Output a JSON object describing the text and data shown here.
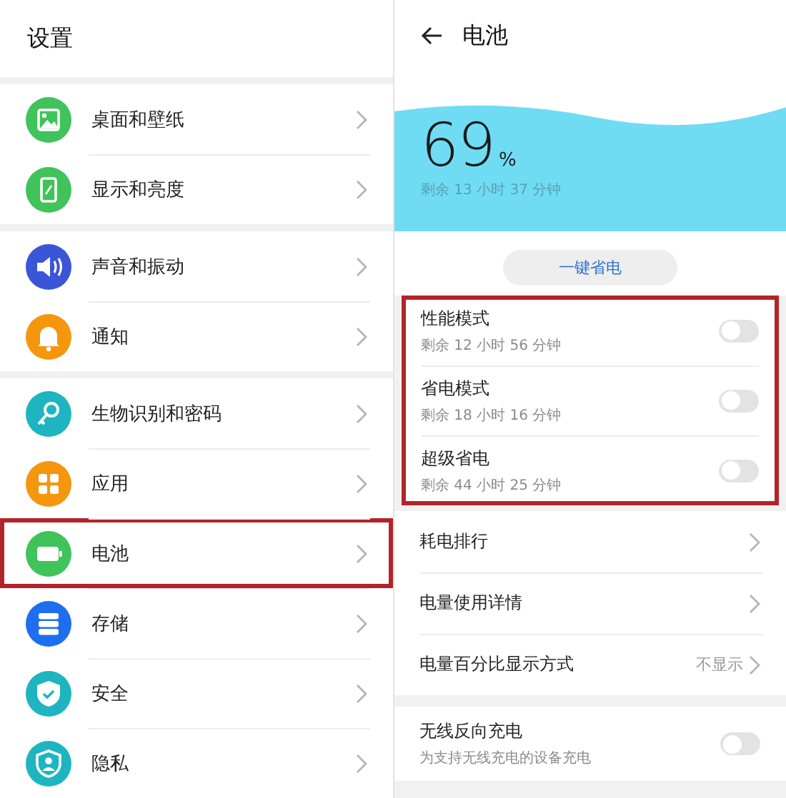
{
  "settings": {
    "title": "设置",
    "groups": [
      {
        "items": [
          {
            "label": "桌面和壁纸",
            "kind": "image",
            "color": "#3fc35a",
            "highlighted": false
          },
          {
            "label": "显示和亮度",
            "kind": "display",
            "color": "#3fc35a",
            "highlighted": false
          }
        ]
      },
      {
        "items": [
          {
            "label": "声音和振动",
            "kind": "sound",
            "color": "#3b55d9",
            "highlighted": false
          },
          {
            "label": "通知",
            "kind": "bell",
            "color": "#f5960f",
            "highlighted": false
          }
        ]
      },
      {
        "items": [
          {
            "label": "生物识别和密码",
            "kind": "key",
            "color": "#1eb5c0",
            "highlighted": false
          },
          {
            "label": "应用",
            "kind": "apps",
            "color": "#f5960f",
            "highlighted": false
          },
          {
            "label": "电池",
            "kind": "battery",
            "color": "#3fc35a",
            "highlighted": true
          },
          {
            "label": "存储",
            "kind": "storage",
            "color": "#1f6ef0",
            "highlighted": false
          },
          {
            "label": "安全",
            "kind": "shield",
            "color": "#1eb5c0",
            "highlighted": false
          },
          {
            "label": "隐私",
            "kind": "privacy",
            "color": "#1eb5c0",
            "highlighted": false
          }
        ]
      }
    ]
  },
  "battery": {
    "title": "电池",
    "percent": "69",
    "percent_sign": "%",
    "remaining": "剩余 13 小时 37 分钟",
    "save_button": "一键省电",
    "modes_highlighted": true,
    "modes": [
      {
        "title": "性能模式",
        "subtitle": "剩余 12 小时 56 分钟",
        "on": false
      },
      {
        "title": "省电模式",
        "subtitle": "剩余 18 小时 16 分钟",
        "on": false
      },
      {
        "title": "超级省电",
        "subtitle": "剩余 44 小时 25 分钟",
        "on": false
      }
    ],
    "links": [
      {
        "label": "耗电排行"
      },
      {
        "label": "电量使用详情"
      },
      {
        "label": "电量百分比显示方式",
        "value": "不显示"
      }
    ],
    "wireless": {
      "title": "无线反向充电",
      "subtitle": "为支持无线充电的设备充电",
      "on": false
    }
  }
}
